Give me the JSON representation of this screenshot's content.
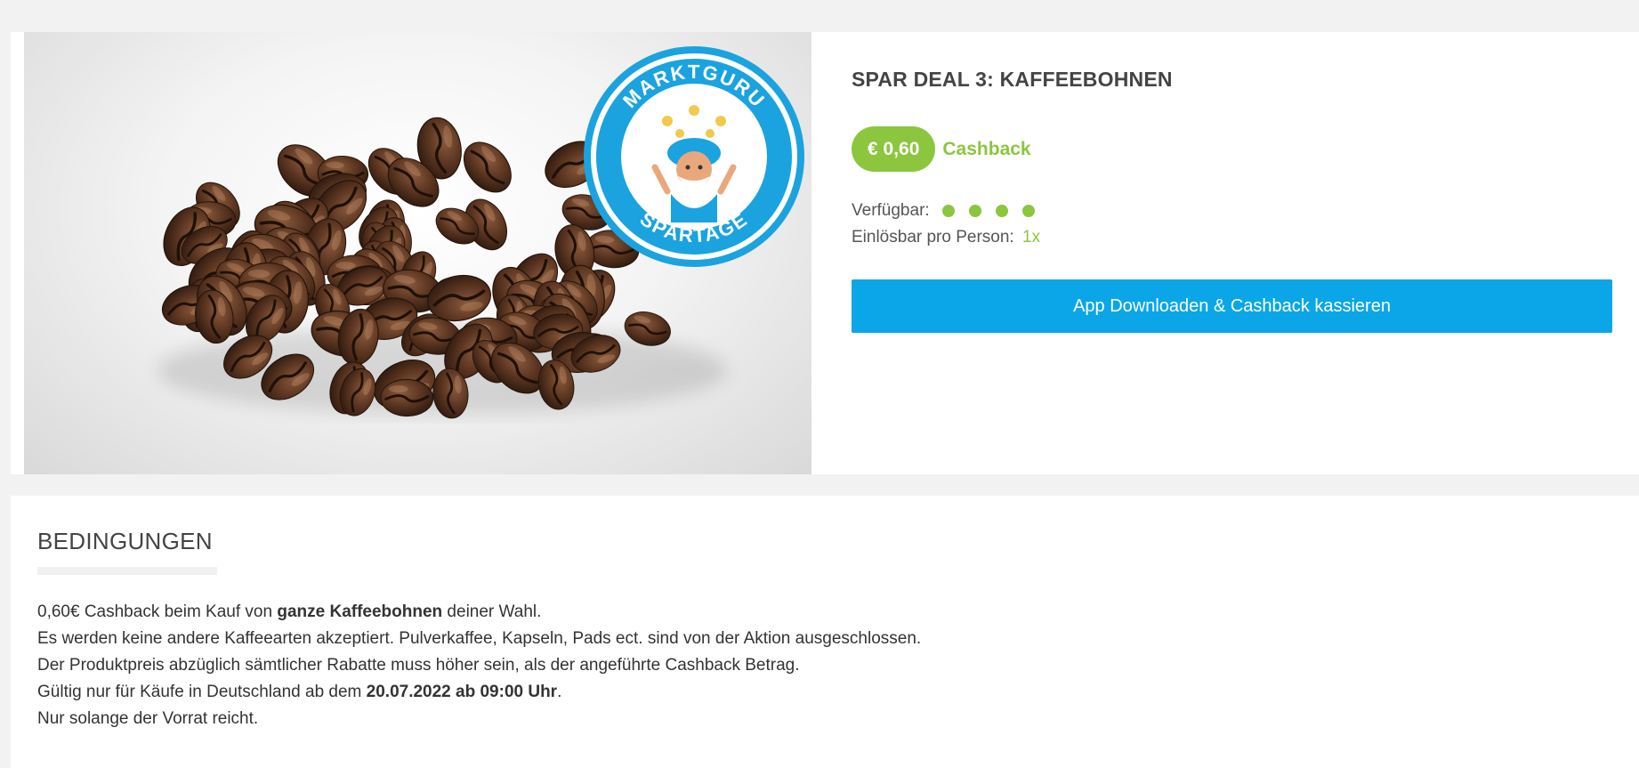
{
  "deal": {
    "title": "SPAR DEAL 3: KAFFEEBOHNEN",
    "price": "€ 0,60",
    "cashback_label": "Cashback",
    "available_label": "Verfügbar:",
    "available_level": 4,
    "per_person_label": "Einlösbar pro Person:",
    "per_person_value": "1x",
    "cta_label": "App Downloaden & Cashback kassieren"
  },
  "image": {
    "subject": "coffee-beans",
    "badge": {
      "top_text": "MARKTGURU",
      "bottom_text": "SPARTAGE"
    }
  },
  "conditions": {
    "title": "BEDINGUNGEN",
    "line1": {
      "pre": "0,60€ Cashback beim Kauf von ",
      "bold": "ganze Kaffeebohnen",
      "post": " deiner Wahl."
    },
    "line2": "Es werden keine andere Kaffeearten akzeptiert. Pulverkaffee, Kapseln, Pads ect. sind von der Aktion ausgeschlossen.",
    "line3": "Der Produktpreis abzüglich sämtlicher Rabatte muss höher sein, als der angeführte Cashback Betrag.",
    "line4": {
      "pre": "Gültig nur für Käufe in Deutschland ab dem ",
      "bold": "20.07.2022 ab 09:00 Uhr",
      "post": "."
    },
    "line5": "Nur solange der Vorrat reicht."
  },
  "colors": {
    "accent_green": "#8cc63f",
    "cta_blue": "#0ba6e8",
    "badge_blue": "#1aa3df"
  }
}
